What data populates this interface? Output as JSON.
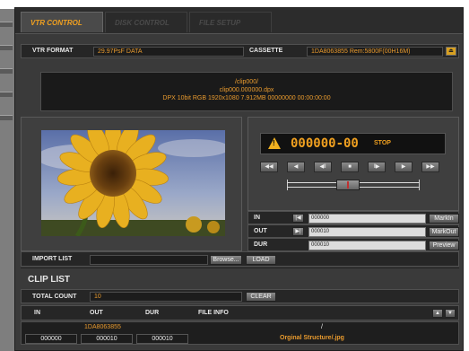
{
  "tabs": [
    {
      "label": "VTR CONTROL"
    },
    {
      "label": "DISK CONTROL"
    },
    {
      "label": "FILE SETUP"
    }
  ],
  "vtr_format": {
    "label": "VTR FORMAT",
    "value": "29.97PsF DATA"
  },
  "cassette": {
    "label": "CASSETTE",
    "value": "1DA8063855  Rem:5800F(00H16M)"
  },
  "info": {
    "line1": "/clip000/",
    "line2": "clip000.000000.dpx",
    "line3": "DPX 10bit RGB 1920x1080 7.912MB 00000000 00:00:00:00"
  },
  "timecode": {
    "value": "000000-00",
    "status": "STOP"
  },
  "transport": [
    "fast-rewind-icon",
    "rewind-icon",
    "step-back-icon",
    "stop-icon",
    "step-forward-icon",
    "play-icon",
    "fast-forward-icon"
  ],
  "transport_glyphs": [
    "◀◀",
    "◀",
    "◀‖",
    "■",
    "‖▶",
    "▶",
    "▶▶"
  ],
  "shuttle": {
    "position": 0.45
  },
  "marks": {
    "in": {
      "label": "IN",
      "value": "000000",
      "button": "MarkIn",
      "icon": "|◀"
    },
    "out": {
      "label": "OUT",
      "value": "000010",
      "button": "MarkOut",
      "icon": "▶|"
    },
    "dur": {
      "label": "DUR",
      "value": "000010",
      "button": "Preview"
    }
  },
  "import": {
    "label": "IMPORT LIST",
    "value": "",
    "browse": "Browse...",
    "load": "LOAD"
  },
  "clip_list": {
    "title": "CLIP LIST",
    "total_count_label": "TOTAL COUNT",
    "total_count": "10",
    "clear": "CLEAR",
    "headers": {
      "in": "IN",
      "out": "OUT",
      "dur": "DUR",
      "file_info": "FILE INFO"
    },
    "row": {
      "cassette": "1DA8063855",
      "in": "000000",
      "out": "000010",
      "dur": "000010",
      "path": "/",
      "file": "Orginal Structure/.jpg"
    }
  },
  "colors": {
    "accent": "#f0a020",
    "panel": "#3a3a3a",
    "field": "#1c1c1c"
  }
}
